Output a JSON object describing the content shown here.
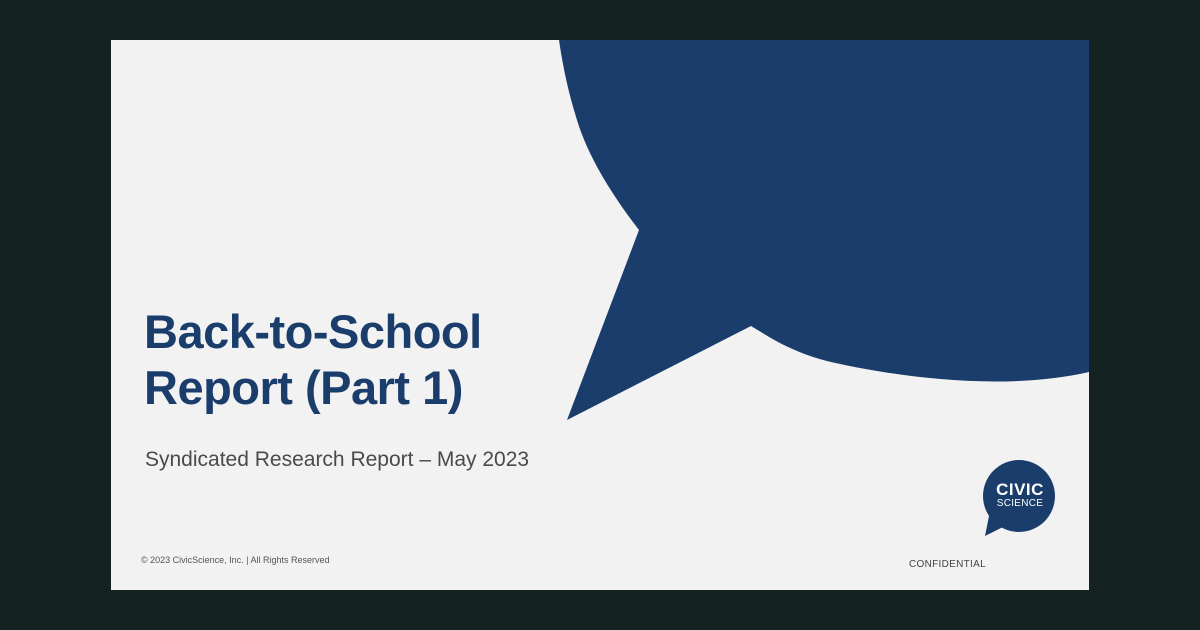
{
  "slide": {
    "title_line1": "Back-to-School",
    "title_line2": "Report (Part 1)",
    "subtitle": "Syndicated Research Report – May 2023",
    "copyright": "© 2023 CivicScience, Inc. | All Rights Reserved",
    "confidential": "CONFIDENTIAL"
  },
  "logo": {
    "line1": "CIVIC",
    "line2": "SCIENCE"
  },
  "colors": {
    "background": "#142222",
    "slide": "#f2f2f2",
    "brand_navy": "#1a3d6c",
    "subtitle_gray": "#4a4a4a"
  },
  "icons": {
    "decor": "speech-bubble-shape",
    "logo": "civicscience-speech-bubble-logo"
  }
}
